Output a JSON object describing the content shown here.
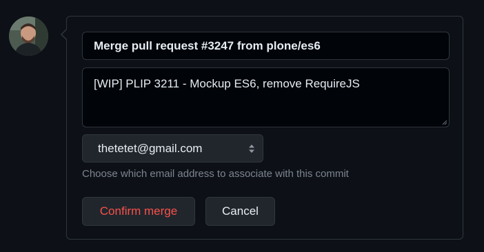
{
  "merge_form": {
    "title_value": "Merge pull request #3247 from plone/es6",
    "body_value": "[WIP] PLIP 3211 - Mockup ES6, remove RequireJS",
    "email_selected": "thetetet@gmail.com",
    "email_hint": "Choose which email address to associate with this commit",
    "confirm_label": "Confirm merge",
    "cancel_label": "Cancel"
  },
  "icons": {
    "avatar": "user-avatar",
    "select": "select-arrows-icon"
  },
  "colors": {
    "background": "#0d1117",
    "input_background": "#010409",
    "border": "#30363d",
    "button_background": "#21262d",
    "danger_text": "#f85149",
    "primary_text": "#e6edf3",
    "muted_text": "#7d8590"
  }
}
